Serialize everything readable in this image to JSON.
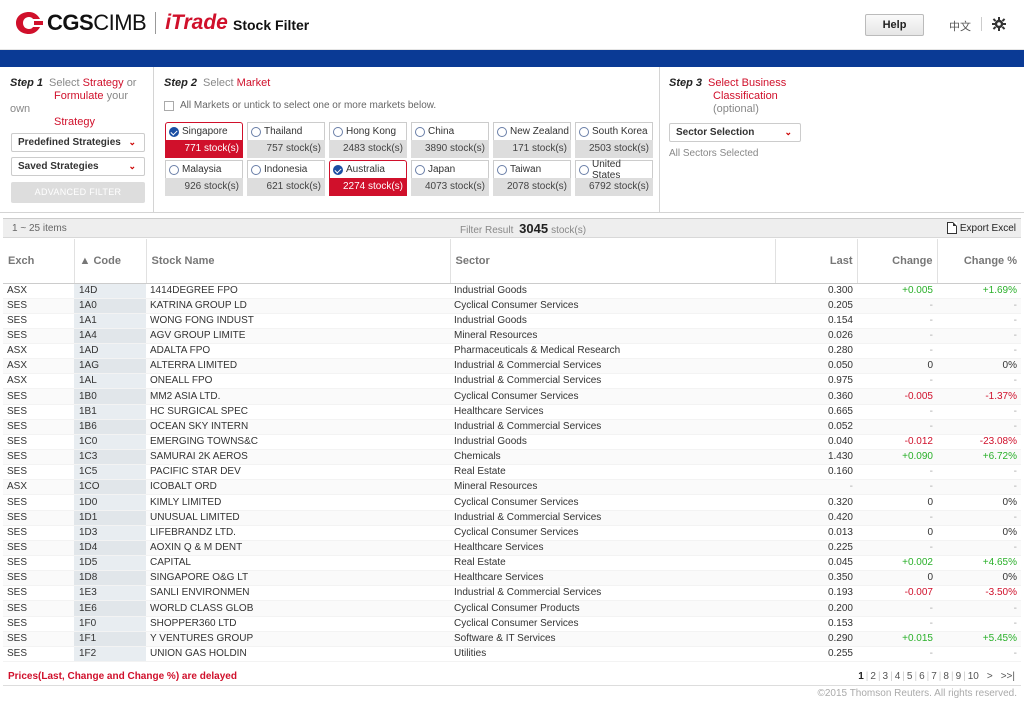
{
  "header": {
    "brand_cgs": "CGS",
    "brand_cimb": "CIMB",
    "brand_itrade": "iTrade",
    "title": "Stock Filter",
    "help_label": "Help",
    "lang_label": "中文",
    "accent_color": "#d0102b",
    "nav_color": "#0a3a95"
  },
  "step1": {
    "num": "Step 1",
    "t1": "Select",
    "t2": "Strategy",
    "t3": "or",
    "t4": "Formulate",
    "t5": "your own",
    "t6": "Strategy",
    "predefined": "Predefined Strategies",
    "saved": "Saved Strategies",
    "advanced": "ADVANCED FILTER"
  },
  "step2": {
    "num": "Step 2",
    "t1": "Select",
    "t2": "Market",
    "all_markets": "All Markets or untick to select one or more markets below.",
    "markets": [
      {
        "name": "Singapore",
        "count": "771 stock(s)",
        "selected": true
      },
      {
        "name": "Thailand",
        "count": "757 stock(s)",
        "selected": false
      },
      {
        "name": "Hong Kong",
        "count": "2483 stock(s)",
        "selected": false
      },
      {
        "name": "China",
        "count": "3890 stock(s)",
        "selected": false
      },
      {
        "name": "New Zealand",
        "count": "171 stock(s)",
        "selected": false
      },
      {
        "name": "South Korea",
        "count": "2503 stock(s)",
        "selected": false
      },
      {
        "name": "Malaysia",
        "count": "926 stock(s)",
        "selected": false
      },
      {
        "name": "Indonesia",
        "count": "621 stock(s)",
        "selected": false
      },
      {
        "name": "Australia",
        "count": "2274 stock(s)",
        "selected": true
      },
      {
        "name": "Japan",
        "count": "4073 stock(s)",
        "selected": false
      },
      {
        "name": "Taiwan",
        "count": "2078 stock(s)",
        "selected": false
      },
      {
        "name": "United States",
        "count": "6792 stock(s)",
        "selected": false
      }
    ]
  },
  "step3": {
    "num": "Step 3",
    "t1": "Select Business",
    "t2": "Classification",
    "t3": "(optional)",
    "sector_selection": "Sector Selection",
    "sectors_note": "All Sectors Selected"
  },
  "results": {
    "items": "1 ~ 25 items",
    "label": "Filter Result",
    "count": "3045",
    "unit": "stock(s)",
    "export": "Export Excel"
  },
  "table": {
    "headers": [
      "Exch",
      "▲ Code",
      "Stock Name",
      "Sector",
      "Last",
      "Change",
      "Change %"
    ],
    "rows": [
      [
        "ASX",
        "14D",
        "1414DEGREE FPO",
        "Industrial Goods",
        "0.300",
        "+0.005",
        "+1.69%"
      ],
      [
        "SES",
        "1A0",
        "KATRINA GROUP LD",
        "Cyclical Consumer Services",
        "0.205",
        "-",
        "-"
      ],
      [
        "SES",
        "1A1",
        "WONG FONG INDUST",
        "Industrial Goods",
        "0.154",
        "-",
        "-"
      ],
      [
        "SES",
        "1A4",
        "AGV GROUP LIMITE",
        "Mineral Resources",
        "0.026",
        "-",
        "-"
      ],
      [
        "ASX",
        "1AD",
        "ADALTA FPO",
        "Pharmaceuticals & Medical Research",
        "0.280",
        "-",
        "-"
      ],
      [
        "ASX",
        "1AG",
        "ALTERRA LIMITED",
        "Industrial & Commercial Services",
        "0.050",
        "0",
        "0%"
      ],
      [
        "ASX",
        "1AL",
        "ONEALL FPO",
        "Industrial & Commercial Services",
        "0.975",
        "-",
        "-"
      ],
      [
        "SES",
        "1B0",
        "MM2 ASIA LTD.",
        "Cyclical Consumer Services",
        "0.360",
        "-0.005",
        "-1.37%"
      ],
      [
        "SES",
        "1B1",
        "HC SURGICAL SPEC",
        "Healthcare Services",
        "0.665",
        "-",
        "-"
      ],
      [
        "SES",
        "1B6",
        "OCEAN SKY INTERN",
        "Industrial & Commercial Services",
        "0.052",
        "-",
        "-"
      ],
      [
        "SES",
        "1C0",
        "EMERGING TOWNS&C",
        "Industrial Goods",
        "0.040",
        "-0.012",
        "-23.08%"
      ],
      [
        "SES",
        "1C3",
        "SAMURAI 2K AEROS",
        "Chemicals",
        "1.430",
        "+0.090",
        "+6.72%"
      ],
      [
        "SES",
        "1C5",
        "PACIFIC STAR DEV",
        "Real Estate",
        "0.160",
        "-",
        "-"
      ],
      [
        "ASX",
        "1CO",
        "ICOBALT ORD",
        "Mineral Resources",
        "-",
        "-",
        "-"
      ],
      [
        "SES",
        "1D0",
        "KIMLY LIMITED",
        "Cyclical Consumer Services",
        "0.320",
        "0",
        "0%"
      ],
      [
        "SES",
        "1D1",
        "UNUSUAL LIMITED",
        "Industrial & Commercial Services",
        "0.420",
        "-",
        "-"
      ],
      [
        "SES",
        "1D3",
        "LIFEBRANDZ LTD.",
        "Cyclical Consumer Services",
        "0.013",
        "0",
        "0%"
      ],
      [
        "SES",
        "1D4",
        "AOXIN Q & M DENT",
        "Healthcare Services",
        "0.225",
        "-",
        "-"
      ],
      [
        "SES",
        "1D5",
        "CAPITAL",
        "Real Estate",
        "0.045",
        "+0.002",
        "+4.65%"
      ],
      [
        "SES",
        "1D8",
        "SINGAPORE O&G LT",
        "Healthcare Services",
        "0.350",
        "0",
        "0%"
      ],
      [
        "SES",
        "1E3",
        "SANLI ENVIRONMEN",
        "Industrial & Commercial Services",
        "0.193",
        "-0.007",
        "-3.50%"
      ],
      [
        "SES",
        "1E6",
        "WORLD CLASS GLOB",
        "Cyclical Consumer Products",
        "0.200",
        "-",
        "-"
      ],
      [
        "SES",
        "1F0",
        "SHOPPER360 LTD",
        "Cyclical Consumer Services",
        "0.153",
        "-",
        "-"
      ],
      [
        "SES",
        "1F1",
        "Y VENTURES GROUP",
        "Software & IT Services",
        "0.290",
        "+0.015",
        "+5.45%"
      ],
      [
        "SES",
        "1F2",
        "UNION GAS HOLDIN",
        "Utilities",
        "0.255",
        "-",
        "-"
      ]
    ]
  },
  "footer": {
    "delay_note": "Prices(Last, Change and Change %) are delayed",
    "pages": [
      "1",
      "2",
      "3",
      "4",
      "5",
      "6",
      "7",
      "8",
      "9",
      "10"
    ],
    "next": ">",
    "last": ">>|",
    "copyright": "©2015 Thomson Reuters. All rights reserved."
  }
}
